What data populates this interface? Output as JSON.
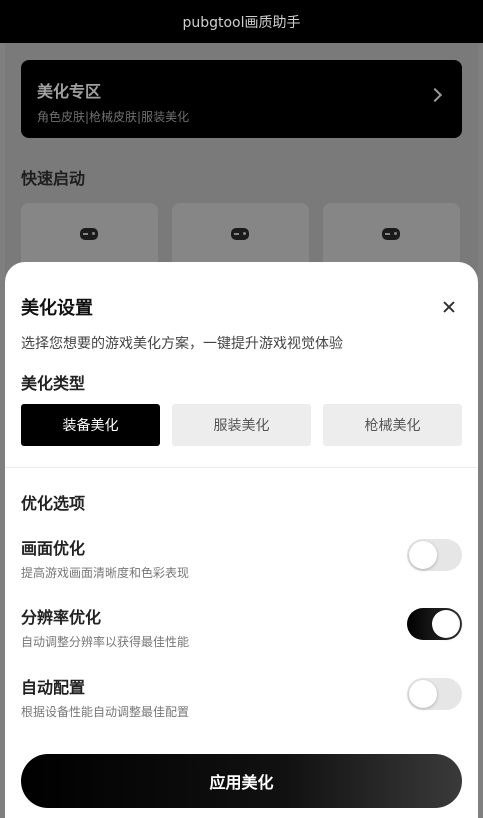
{
  "app": {
    "title": "pubgtool画质助手"
  },
  "promo": {
    "title": "美化专区",
    "subtitle": "角色皮肤|枪械皮肤|服装美化"
  },
  "quick": {
    "heading": "快速启动",
    "tiles": [
      "gamepad-icon",
      "gamepad-icon",
      "gamepad-icon"
    ]
  },
  "sheet": {
    "title": "美化设置",
    "subtitle": "选择您想要的游戏美化方案，一键提升游戏视觉体验",
    "type_label": "美化类型",
    "tabs": [
      {
        "label": "装备美化",
        "active": true
      },
      {
        "label": "服装美化",
        "active": false
      },
      {
        "label": "枪械美化",
        "active": false
      }
    ],
    "options_label": "优化选项",
    "options": [
      {
        "title": "画面优化",
        "desc": "提高游戏画面清晰度和色彩表现",
        "enabled": false
      },
      {
        "title": "分辨率优化",
        "desc": "自动调整分辨率以获得最佳性能",
        "enabled": true
      },
      {
        "title": "自动配置",
        "desc": "根据设备性能自动调整最佳配置",
        "enabled": false
      }
    ],
    "apply_label": "应用美化"
  },
  "colors": {
    "accent": "#000000",
    "overlay": "#7f7f7f",
    "tab_inactive": "#ededed"
  }
}
